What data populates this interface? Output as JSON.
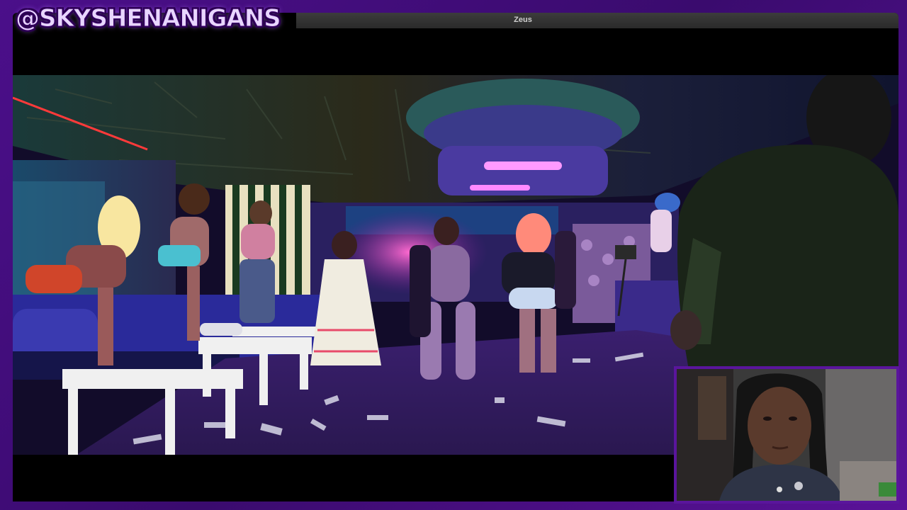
{
  "overlay": {
    "handle": "@SKYSHENANIGANS"
  },
  "window": {
    "title": "Zeus"
  },
  "colors": {
    "frame": "#4b0f8a",
    "accent": "#b070ff"
  }
}
